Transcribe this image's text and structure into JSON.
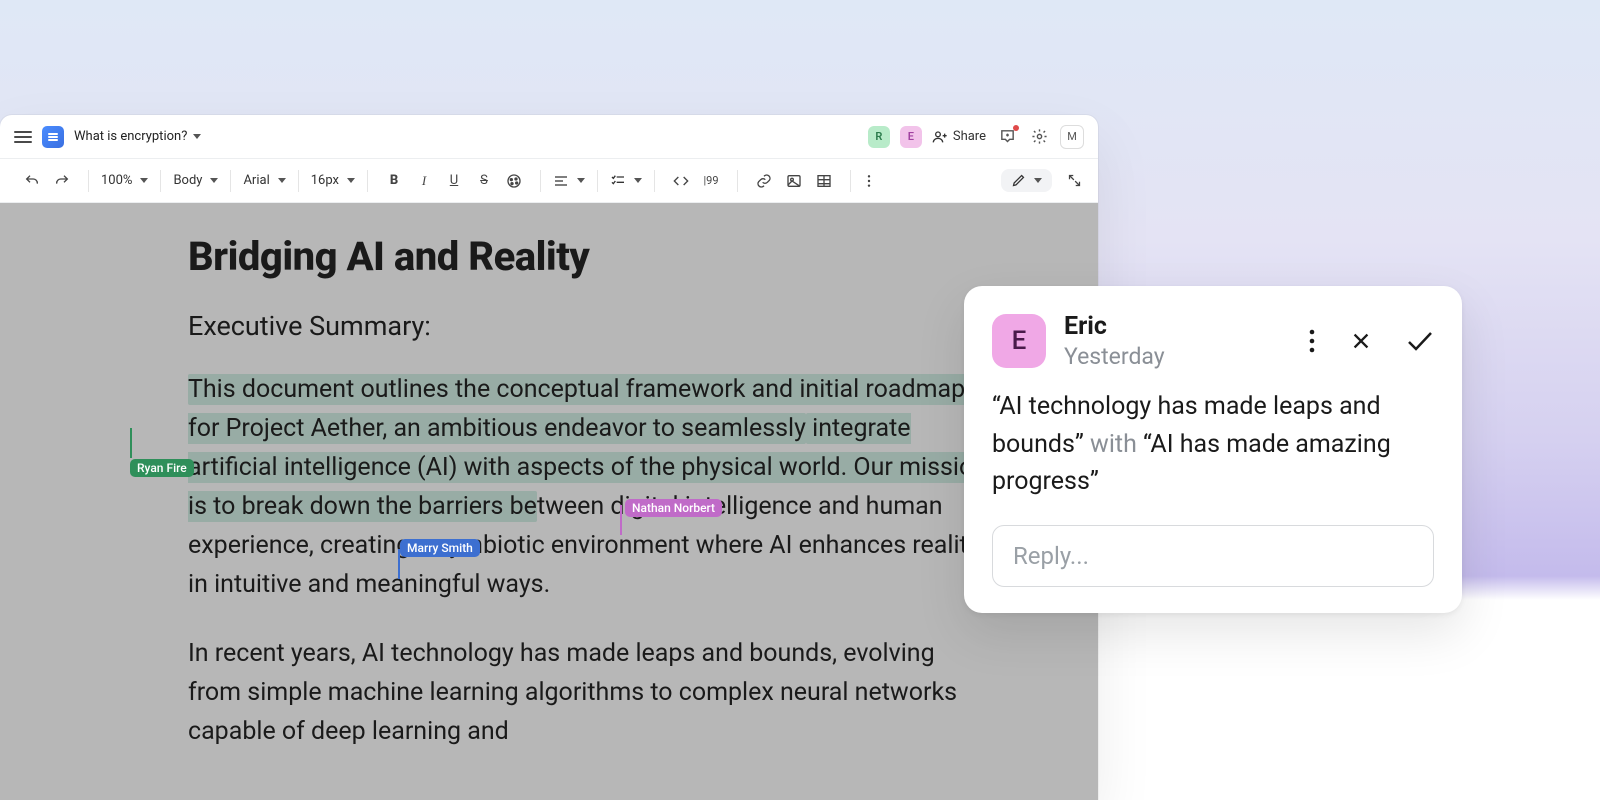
{
  "topbar": {
    "doc_title": "What is encryption?",
    "share_label": "Share",
    "avatars": {
      "r": "R",
      "e": "E",
      "m": "M"
    }
  },
  "toolbar": {
    "zoom": "100%",
    "style": "Body",
    "font": "Arial",
    "size": "16px",
    "line_number": "99"
  },
  "document": {
    "title": "Bridging AI and Reality",
    "subtitle": "Executive Summary:",
    "para1_pre": "This document outlines the conceptual framework and initial roadmap for Project Aether, an ambitious endeavor to seamlessly",
    "para1_mid": " integrate artificial intelligence (AI) with aspects of the physical world. Our mission is to break down the barriers be",
    "para1_post_hl": "tween digital intelligence and human experience, creating a symbiotic environment where AI enhances reality in intuitive and meaningful ways.",
    "para2": "In recent years, AI technology has made leaps and bounds, evolving from simple machine learning algorithms to complex neural networks capable of deep learning and"
  },
  "collaborators": {
    "tag1": "Ryan Fire",
    "tag2": "Nathan Norbert",
    "tag3": "Marry Smith"
  },
  "comment": {
    "avatar_letter": "E",
    "author": "Eric",
    "when": "Yesterday",
    "body_q1": "“AI technology has made leaps and bounds”",
    "body_connector": " with ",
    "body_q2": "“AI has made amazing progress”",
    "reply_placeholder": "Reply..."
  }
}
